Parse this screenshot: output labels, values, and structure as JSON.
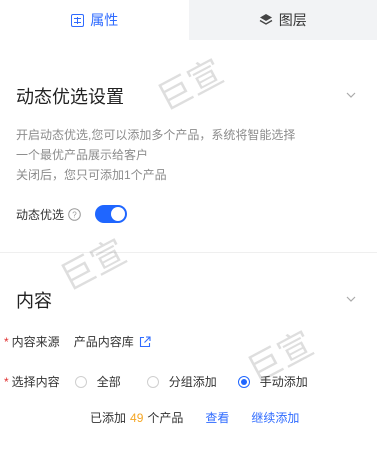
{
  "tabs": [
    {
      "label": "属性",
      "icon": "properties-icon",
      "active": true
    },
    {
      "label": "图层",
      "icon": "layers-icon",
      "active": false
    }
  ],
  "dynamic_section": {
    "title": "动态优选设置",
    "desc_line1": "开启动态优选,您可以添加多个产品，系统将智能选择",
    "desc_line2": "一个最优产品展示给客户",
    "desc_line3": "关闭后，您只可添加1个产品",
    "toggle_label": "动态优选",
    "toggle_on": true
  },
  "content_section": {
    "title": "内容",
    "source_label": "内容来源",
    "source_value": "产品内容库",
    "select_label": "选择内容",
    "options": [
      "全部",
      "分组添加",
      "手动添加"
    ],
    "selected": "手动添加",
    "added_prefix": "已添加",
    "added_count": "49",
    "added_suffix": "个产品",
    "view_link": "查看",
    "continue_link": "继续添加"
  },
  "watermark_text": "巨宣",
  "colors": {
    "accent": "#1f66ff",
    "required": "#e03030",
    "count": "#f5a623"
  }
}
